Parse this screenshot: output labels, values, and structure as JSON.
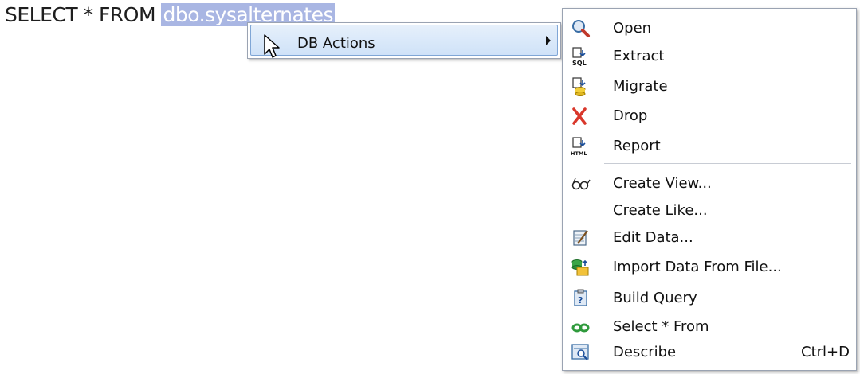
{
  "editor": {
    "sql_prefix": "SELECT * FROM ",
    "sql_selected": "dbo.sysalternates"
  },
  "context_menu": {
    "parent_item_label": "DB Actions"
  },
  "submenu": {
    "items": [
      {
        "label": "Open",
        "icon": "open-magnifier-icon",
        "shortcut": ""
      },
      {
        "label": "Extract",
        "icon": "extract-sql-icon",
        "shortcut": ""
      },
      {
        "label": "Migrate",
        "icon": "migrate-icon",
        "shortcut": ""
      },
      {
        "label": "Drop",
        "icon": "drop-x-icon",
        "shortcut": ""
      },
      {
        "label": "Report",
        "icon": "report-html-icon",
        "shortcut": ""
      },
      {
        "label": "Create View...",
        "icon": "glasses-icon",
        "shortcut": ""
      },
      {
        "label": "Create Like...",
        "icon": "",
        "shortcut": ""
      },
      {
        "label": "Edit Data...",
        "icon": "edit-data-icon",
        "shortcut": ""
      },
      {
        "label": "Import Data From File...",
        "icon": "import-data-icon",
        "shortcut": ""
      },
      {
        "label": "Build Query",
        "icon": "build-query-icon",
        "shortcut": ""
      },
      {
        "label": "Select * From",
        "icon": "select-from-icon",
        "shortcut": ""
      },
      {
        "label": "Describe",
        "icon": "describe-icon",
        "shortcut": "Ctrl+D"
      }
    ]
  },
  "colors": {
    "selection": "#a9b6e3",
    "highlight": "#cfe2f8",
    "drop_red": "#d9372b"
  }
}
